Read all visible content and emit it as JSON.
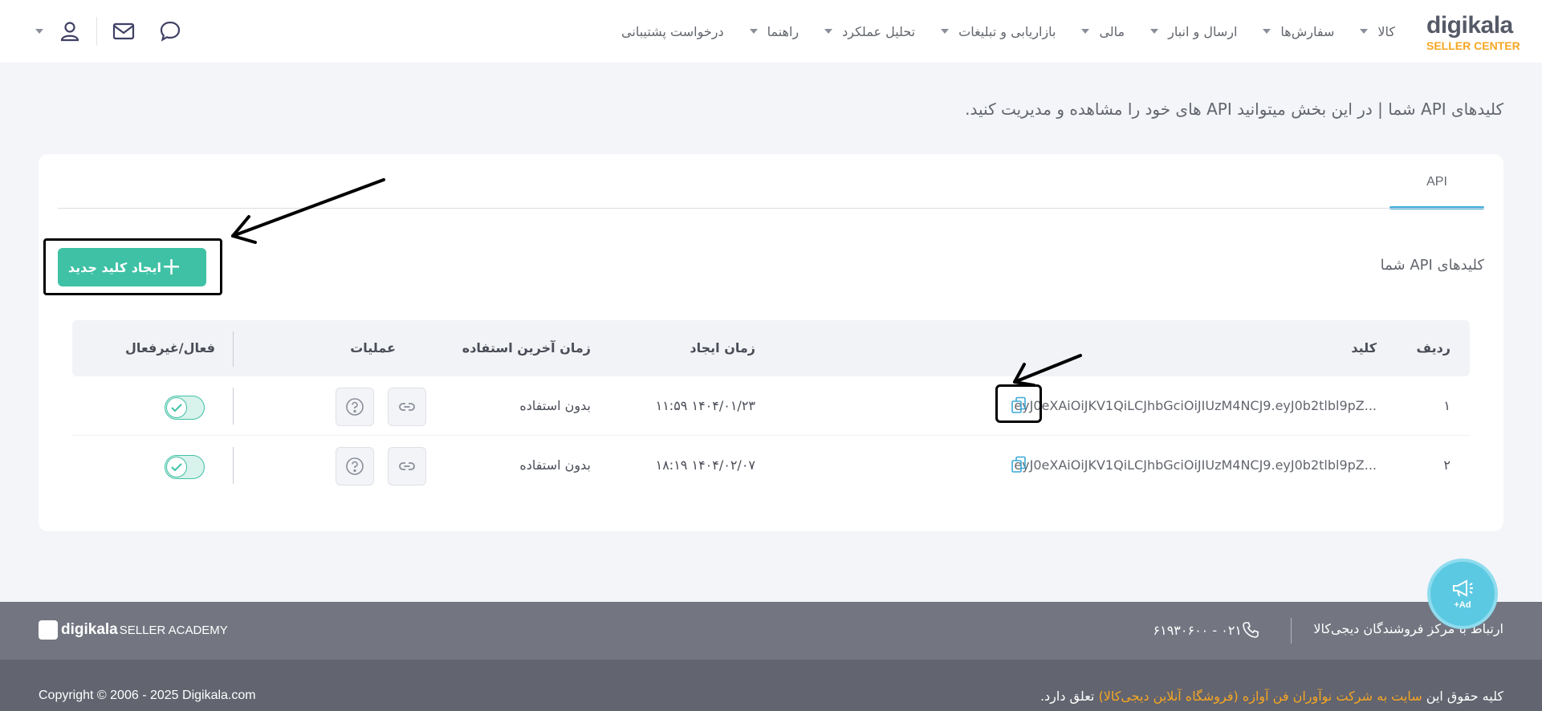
{
  "header": {
    "logo": {
      "main": "digikala",
      "sub": "SELLER CENTER"
    },
    "nav": [
      {
        "label": "کالا",
        "has_dropdown": true
      },
      {
        "label": "سفارش‌ها",
        "has_dropdown": true
      },
      {
        "label": "ارسال و انبار",
        "has_dropdown": true
      },
      {
        "label": "مالی",
        "has_dropdown": true
      },
      {
        "label": "بازاریابی و تبلیغات",
        "has_dropdown": true
      },
      {
        "label": "تحلیل عملکرد",
        "has_dropdown": true
      },
      {
        "label": "راهنما",
        "has_dropdown": true
      },
      {
        "label": "درخواست پشتیبانی",
        "has_dropdown": false
      }
    ],
    "icons": [
      "chat-icon",
      "mail-icon",
      "user-icon"
    ]
  },
  "page": {
    "title": "کلیدهای API شما | در این بخش میتوانید API های خود را مشاهده و مدیریت کنید."
  },
  "card": {
    "tab_label": "API",
    "section_title": "کلیدهای API شما",
    "create_button": "ایجاد کلید جدید",
    "table": {
      "headers": {
        "index": "ردیف",
        "key": "کلید",
        "created": "زمان ایجاد",
        "last_used": "زمان آخرین استفاده",
        "operations": "عملیات",
        "status": "فعال/غیرفعال"
      },
      "rows": [
        {
          "index": "۱",
          "key": "eyJ0eXAiOiJKV1QiLCJhbGciOiJIUzM4NCJ9.eyJ0b2tlbl9pZ...",
          "created": "۱۴۰۴/۰۱/۲۳ ۱۱:۵۹",
          "last_used": "بدون استفاده",
          "active": true
        },
        {
          "index": "۲",
          "key": "eyJ0eXAiOiJKV1QiLCJhbGciOiJIUzM4NCJ9.eyJ0b2tlbl9pZ...",
          "created": "۱۴۰۴/۰۲/۰۷ ۱۸:۱۹",
          "last_used": "بدون استفاده",
          "active": true
        }
      ]
    }
  },
  "footer": {
    "contact_label": "ارتباط با مرکز فروشندگان دیجی‌کالا",
    "phone": "۰۲۱ - ۶۱۹۳۰۶۰۰",
    "academy_brand": "digikala",
    "academy_sub": "SELLER ACADEMY",
    "rights_prefix": "کلیه حقوق این",
    "rights_link": "سایت به شرکت نوآوران فن آوازه (فروشگاه آنلاین دیجی‌کالا)",
    "rights_suffix": "تعلق دارد.",
    "copyright": "Copyright © 2006 - 2025 Digikala.com"
  },
  "fab": {
    "label": "+Ad"
  },
  "colors": {
    "accent_green": "#3fc1a5",
    "tab_blue": "#3aa8d8",
    "logo_orange": "#f6a623",
    "footer_top": "#737681",
    "footer_bottom": "#62646f"
  }
}
